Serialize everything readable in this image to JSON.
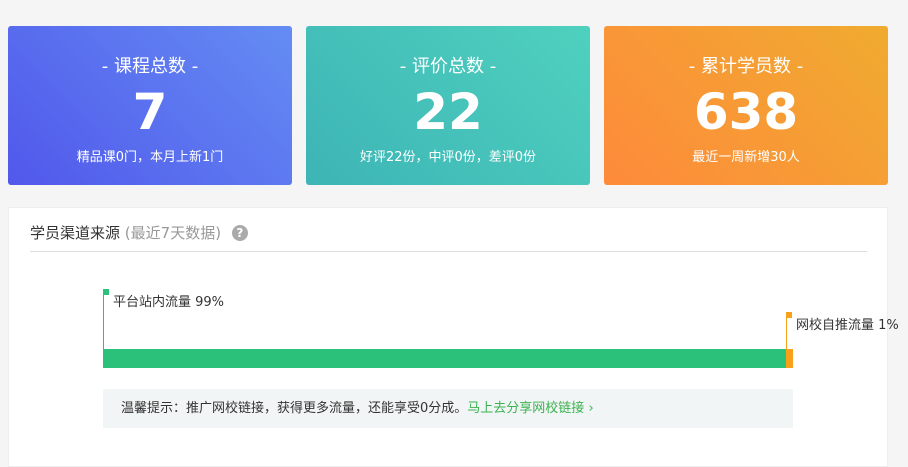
{
  "cards": [
    {
      "title": "- 课程总数 -",
      "value": "7",
      "sub": "精品课0门，本月上新1门"
    },
    {
      "title": "- 评价总数 -",
      "value": "22",
      "sub": "好评22份，中评0份，差评0份"
    },
    {
      "title": "- 累计学员数 -",
      "value": "638",
      "sub": "最近一周新增30人"
    }
  ],
  "panel": {
    "title": "学员渠道来源",
    "subtitle": "(最近7天数据)",
    "help": "?"
  },
  "sources": [
    {
      "label": "平台站内流量 99%",
      "percent": 99,
      "color": "#2bc17a"
    },
    {
      "label": "网校自推流量 1%",
      "percent": 1,
      "color": "#f7a11b"
    }
  ],
  "tip": {
    "text": "温馨提示：推广网校链接，获得更多流量，还能享受0分成。",
    "link": "马上去分享网校链接",
    "chevron": "›"
  }
}
